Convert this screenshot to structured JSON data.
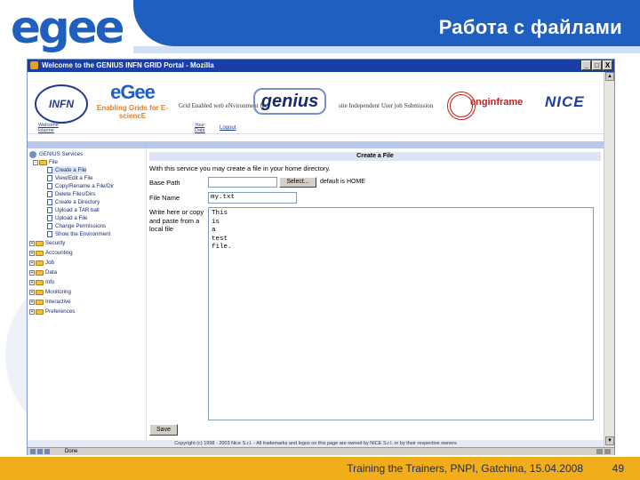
{
  "slide": {
    "title": "Работа с файлами",
    "logo_text": "egee",
    "footer": "Training the Trainers, PNPI, Gatchina, 15.04.2008",
    "page_number": "49"
  },
  "browser": {
    "window_title": "Welcome to the GENIUS INFN GRID Portal - Mozilla",
    "controls": [
      "_",
      "□",
      "X"
    ],
    "status_text": "Done"
  },
  "banner": {
    "infn": "INFN",
    "egee_t1": "eGee",
    "egee_t2": "Enabling Grids for E-sciencE",
    "genius_left": "Grid Enabled web eNvironment for",
    "genius": "genius",
    "genius_right": "site Independent User job Submission",
    "enginframe": "enginframe",
    "nice": "NICE"
  },
  "nav": {
    "welcome": "Welcome lolaone",
    "your": "Your Data",
    "logout": "Logout"
  },
  "sidebar": {
    "root": "GENIUS Services",
    "file": "File",
    "file_items": [
      "Create a File",
      "View/Edit a File",
      "Copy/Rename a File/Dir",
      "Delete Files/Dirs",
      "Create a Directory",
      "Upload a TAR ball",
      "Upload a File",
      "Change Permissions",
      "Show the Environment"
    ],
    "groups": [
      "Security",
      "Accounting",
      "Job",
      "Data",
      "Info",
      "Monitoring",
      "Interactive",
      "Preferences"
    ]
  },
  "form": {
    "header": "Create a File",
    "intro": "With this service you may create a file in your home directory.",
    "base_path_label": "Base Path",
    "select_label": "Select...",
    "default_text": "default is HOME",
    "filename_label": "File Name",
    "filename_value": "my.txt",
    "write_label": "Write here or copy and paste from a local file",
    "content": "This\nis\na\ntest\nfile.",
    "save_label": "Save"
  },
  "copyright": "Copyright (c) 1998 - 2003 Nice S.r.l. - All trademarks and logos on this page are owned by NICE S.r.l. or by their respective owners"
}
